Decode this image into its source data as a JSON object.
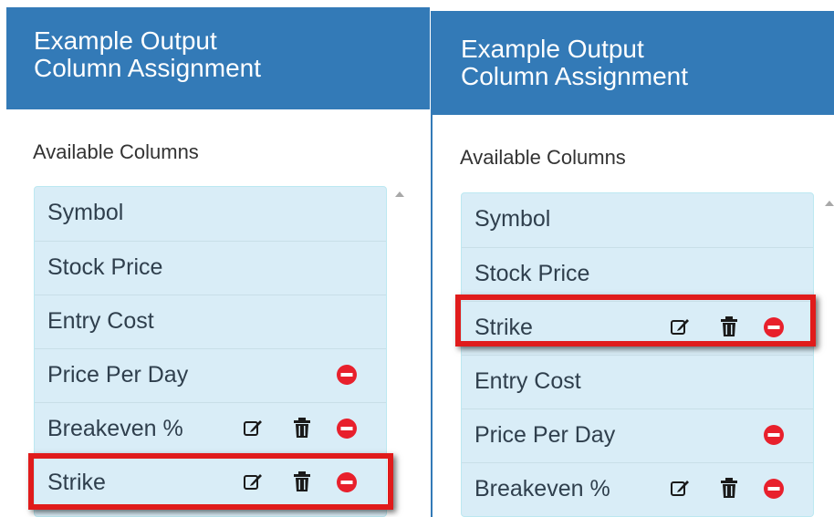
{
  "left": {
    "header": {
      "line1": "Example Output",
      "line2": "Column Assignment"
    },
    "section_label": "Available Columns",
    "rows": [
      {
        "label": "Symbol",
        "icons": []
      },
      {
        "label": "Stock Price",
        "icons": []
      },
      {
        "label": "Entry Cost",
        "icons": []
      },
      {
        "label": "Price Per Day",
        "icons": [
          "minus-circle-icon"
        ]
      },
      {
        "label": "Breakeven %",
        "icons": [
          "edit-icon",
          "trash-icon",
          "minus-circle-icon"
        ]
      },
      {
        "label": "Strike",
        "icons": [
          "edit-icon",
          "trash-icon",
          "minus-circle-icon"
        ],
        "highlighted": true
      }
    ]
  },
  "right": {
    "header": {
      "line1": "Example Output",
      "line2": "Column Assignment"
    },
    "section_label": "Available Columns",
    "rows": [
      {
        "label": "Symbol",
        "icons": []
      },
      {
        "label": "Stock Price",
        "icons": []
      },
      {
        "label": "Strike",
        "icons": [
          "edit-icon",
          "trash-icon",
          "minus-circle-icon"
        ],
        "highlighted": true
      },
      {
        "label": "Entry Cost",
        "icons": []
      },
      {
        "label": "Price Per Day",
        "icons": [
          "minus-circle-icon"
        ]
      },
      {
        "label": "Breakeven %",
        "icons": [
          "edit-icon",
          "trash-icon",
          "minus-circle-icon"
        ]
      }
    ]
  },
  "colors": {
    "header_bg": "#337ab7",
    "list_bg": "#d9edf7",
    "remove_icon": "#e8202c",
    "highlight_border": "#e01b1b"
  }
}
